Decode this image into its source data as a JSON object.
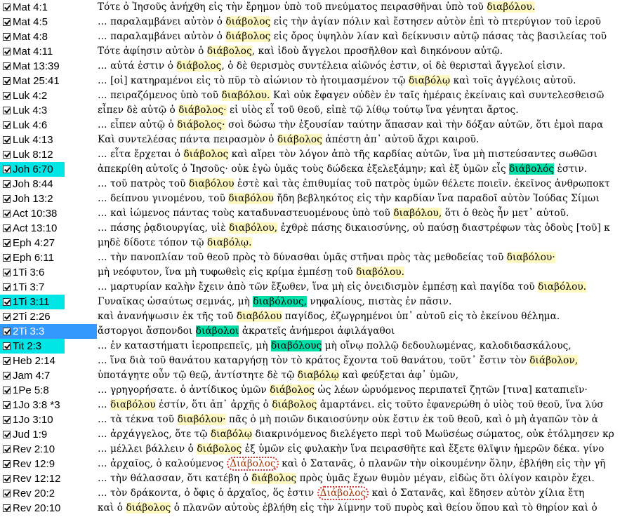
{
  "rows": [
    {
      "ref": "Mat 4:1",
      "sel": "",
      "segs": [
        {
          "t": "Τότε ὁ Ἰησοῦς ἀνήχθη εἰς τὴν ἔρημον ὑπὸ τοῦ πνεύματος πειρασθῆναι ὑπὸ τοῦ "
        },
        {
          "t": "διαβόλου.",
          "h": "hl"
        }
      ]
    },
    {
      "ref": "Mat 4:5",
      "sel": "",
      "segs": [
        {
          "t": "… παραλαμβάνει αὐτὸν ὁ "
        },
        {
          "t": "διάβολος",
          "h": "hl"
        },
        {
          "t": " εἰς τὴν ἁγίαν πόλιν καὶ ἔστησεν αὐτὸν ἐπὶ τὸ πτερύγιον τοῦ ἱεροῦ"
        }
      ]
    },
    {
      "ref": "Mat 4:8",
      "sel": "",
      "segs": [
        {
          "t": "… παραλαμβάνει αὐτὸν ὁ "
        },
        {
          "t": "διάβολος",
          "h": "hl"
        },
        {
          "t": " εἰς ὄρος ὑψηλὸν λίαν καὶ δείκνυσιν αὐτῷ πάσας τὰς βασιλείας τοῦ"
        }
      ]
    },
    {
      "ref": "Mat 4:11",
      "sel": "",
      "segs": [
        {
          "t": "Τότε ἀφίησιν αὐτὸν ὁ "
        },
        {
          "t": "διάβολος",
          "h": "hl"
        },
        {
          "t": ", καὶ ἰδοὺ ἄγγελοι προσῆλθον καὶ διηκόνουν αὐτῷ."
        }
      ]
    },
    {
      "ref": "Mat 13:39",
      "sel": "",
      "segs": [
        {
          "t": "… αὐτά ἐστιν ὁ "
        },
        {
          "t": "διάβολος",
          "h": "hl"
        },
        {
          "t": ", ὁ δὲ θερισμὸς συντέλεια αἰῶνός ἐστιν, οἱ δὲ θερισταὶ ἄγγελοί εἰσιν."
        }
      ]
    },
    {
      "ref": "Mat 25:41",
      "sel": "",
      "segs": [
        {
          "t": "… [οἱ] κατηραμένοι εἰς τὸ πῦρ τὸ αἰώνιον τὸ ἡτοιμασμένον τῷ "
        },
        {
          "t": "διαβόλῳ",
          "h": "hl"
        },
        {
          "t": " καὶ τοῖς ἀγγέλοις αὐτοῦ."
        }
      ]
    },
    {
      "ref": "Luk 4:2",
      "sel": "",
      "segs": [
        {
          "t": "… πειραζόμενος ὑπὸ τοῦ "
        },
        {
          "t": "διαβόλου.",
          "h": "hl"
        },
        {
          "t": " Καὶ οὐκ ἔφαγεν οὐδὲν ἐν ταῖς ἡμέραις ἐκείναις καὶ συντελεσθεισῶ"
        }
      ]
    },
    {
      "ref": "Luk 4:3",
      "sel": "",
      "segs": [
        {
          "t": "εἶπεν δὲ αὐτῷ ὁ "
        },
        {
          "t": "διάβολος·",
          "h": "hl"
        },
        {
          "t": " εἰ υἱὸς εἶ τοῦ θεοῦ, εἰπὲ τῷ λίθῳ τούτῳ ἵνα γένηται ἄρτος."
        }
      ]
    },
    {
      "ref": "Luk 4:6",
      "sel": "",
      "segs": [
        {
          "t": "… εἶπεν αὐτῷ ὁ "
        },
        {
          "t": "διάβολος·",
          "h": "hl"
        },
        {
          "t": " σοὶ δώσω τὴν ἐξουσίαν ταύτην ἅπασαν καὶ τὴν δόξαν αὐτῶν, ὅτι ἐμοὶ παρα"
        }
      ]
    },
    {
      "ref": "Luk 4:13",
      "sel": "",
      "segs": [
        {
          "t": "Καὶ συντελέσας πάντα πειρασμὸν ὁ "
        },
        {
          "t": "διάβολος",
          "h": "hl"
        },
        {
          "t": " ἀπέστη ἀπ᾽ αὐτοῦ ἄχρι καιροῦ."
        }
      ]
    },
    {
      "ref": "Luk 8:12",
      "sel": "",
      "segs": [
        {
          "t": "… εἶτα ἔρχεται ὁ "
        },
        {
          "t": "διάβολος",
          "h": "hl"
        },
        {
          "t": " καὶ αἴρει τὸν λόγον ἀπὸ τῆς καρδίας αὐτῶν, ἵνα μὴ πιστεύσαντες σωθῶσι"
        }
      ]
    },
    {
      "ref": "Joh 6:70",
      "sel": "cyan",
      "segs": [
        {
          "t": "ἀπεκρίθη αὐτοῖς ὁ Ἰησοῦς· οὐκ ἐγὼ ὑμᾶς τοὺς δώδεκα ἐξελεξάμην; καὶ ἐξ ὑμῶν εἷς "
        },
        {
          "t": "διάβολός",
          "h": "hl-strong"
        },
        {
          "t": " ἐστιν."
        }
      ]
    },
    {
      "ref": "Joh 8:44",
      "sel": "",
      "segs": [
        {
          "t": "… τοῦ πατρὸς τοῦ "
        },
        {
          "t": "διαβόλου",
          "h": "hl"
        },
        {
          "t": " ἐστὲ καὶ τὰς ἐπιθυμίας τοῦ πατρὸς ὑμῶν θέλετε ποιεῖν. ἐκεῖνος ἀνθρωποκτ"
        }
      ]
    },
    {
      "ref": "Joh 13:2",
      "sel": "",
      "segs": [
        {
          "t": "… δείπνου γινομένου, τοῦ "
        },
        {
          "t": "διαβόλου",
          "h": "hl"
        },
        {
          "t": " ἤδη βεβληκότος εἰς τὴν καρδίαν ἵνα παραδοῖ αὐτὸν Ἰούδας Σίμωι"
        }
      ]
    },
    {
      "ref": "Act 10:38",
      "sel": "",
      "segs": [
        {
          "t": "… καὶ ἰώμενος πάντας τοὺς καταδυναστευομένους ὑπὸ τοῦ "
        },
        {
          "t": "διαβόλου,",
          "h": "hl"
        },
        {
          "t": " ὅτι ὁ θεὸς ἦν μετ᾽ αὐτοῦ."
        }
      ]
    },
    {
      "ref": "Act 13:10",
      "sel": "",
      "segs": [
        {
          "t": "… πάσης ῥᾳδιουργίας, υἱὲ "
        },
        {
          "t": "διαβόλου,",
          "h": "hl"
        },
        {
          "t": " ἐχθρὲ πάσης δικαιοσύνης, οὐ παύσῃ διαστρέφων τὰς ὁδοὺς [τοῦ] κ"
        }
      ]
    },
    {
      "ref": "Eph 4:27",
      "sel": "",
      "segs": [
        {
          "t": "μηδὲ δίδοτε τόπον τῷ "
        },
        {
          "t": "διαβόλῳ.",
          "h": "hl"
        }
      ]
    },
    {
      "ref": "Eph 6:11",
      "sel": "",
      "segs": [
        {
          "t": "… τὴν πανοπλίαν τοῦ θεοῦ πρὸς τὸ δύνασθαι ὑμᾶς στῆναι πρὸς τὰς μεθοδείας τοῦ "
        },
        {
          "t": "διαβόλου·",
          "h": "hl"
        }
      ]
    },
    {
      "ref": "1Ti 3:6",
      "sel": "",
      "segs": [
        {
          "t": "μὴ νεόφυτον, ἵνα μὴ τυφωθεὶς εἰς κρίμα ἐμπέσῃ τοῦ "
        },
        {
          "t": "διαβόλου.",
          "h": "hl"
        }
      ]
    },
    {
      "ref": "1Ti 3:7",
      "sel": "",
      "segs": [
        {
          "t": "… μαρτυρίαν καλὴν ἔχειν ἀπὸ τῶν ἔξωθεν, ἵνα μὴ εἰς ὀνειδισμὸν ἐμπέσῃ καὶ παγίδα τοῦ "
        },
        {
          "t": "διαβόλου.",
          "h": "hl"
        }
      ]
    },
    {
      "ref": "1Ti 3:11",
      "sel": "cyan",
      "segs": [
        {
          "t": "Γυναῖκας ὡσαύτως σεμνάς, μὴ "
        },
        {
          "t": "διαβόλους,",
          "h": "hl-strong"
        },
        {
          "t": " νηφαλίους, πιστὰς ἐν πᾶσιν."
        }
      ]
    },
    {
      "ref": "2Ti 2:26",
      "sel": "",
      "segs": [
        {
          "t": "καὶ ἀνανήψωσιν ἐκ τῆς τοῦ "
        },
        {
          "t": "διαβόλου",
          "h": "hl"
        },
        {
          "t": " παγίδος, ἐζωγρημένοι ὑπ᾽ αὐτοῦ εἰς τὸ ἐκείνου θέλημα."
        }
      ]
    },
    {
      "ref": "2Ti 3:3",
      "sel": "blue",
      "segs": [
        {
          "t": "ἄστοργοι ἄσπονδοι "
        },
        {
          "t": "διάβολοι",
          "h": "hl-strong"
        },
        {
          "t": " ἀκρατεῖς ἀνήμεροι ἀφιλάγαθοι"
        }
      ]
    },
    {
      "ref": "Tit 2:3",
      "sel": "cyan",
      "segs": [
        {
          "t": "… ἐν καταστήματι ἱεροπρεπεῖς, μὴ "
        },
        {
          "t": "διαβόλους",
          "h": "hl-strong"
        },
        {
          "t": " μὴ οἴνῳ πολλῷ δεδουλωμένας, καλοδιδασκάλους,"
        }
      ]
    },
    {
      "ref": "Heb 2:14",
      "sel": "",
      "segs": [
        {
          "t": "… ἵνα διὰ τοῦ θανάτου καταργήσῃ τὸν τὸ κράτος ἔχοντα τοῦ θανάτου, τοῦτ᾽ ἔστιν τὸν "
        },
        {
          "t": "διάβολον,",
          "h": "hl"
        }
      ]
    },
    {
      "ref": "Jam 4:7",
      "sel": "",
      "segs": [
        {
          "t": "ὑποτάγητε οὖν τῷ θεῷ, ἀντίστητε δὲ τῷ "
        },
        {
          "t": "διαβόλῳ",
          "h": "hl"
        },
        {
          "t": " καὶ φεύξεται ἀφ᾽ ὑμῶν,"
        }
      ]
    },
    {
      "ref": "1Pe 5:8",
      "sel": "",
      "segs": [
        {
          "t": "… γρηγορήσατε. ὁ ἀντίδικος ὑμῶν "
        },
        {
          "t": "διάβολος",
          "h": "hl"
        },
        {
          "t": " ὡς λέων ὠρυόμενος περιπατεῖ ζητῶν [τινα] καταπιεῖν·"
        }
      ]
    },
    {
      "ref": "1Jo 3:8 *3",
      "sel": "",
      "segs": [
        {
          "t": "… "
        },
        {
          "t": "διαβόλου",
          "h": "hl"
        },
        {
          "t": " ἐστίν, ὅτι ἀπ᾽ ἀρχῆς ὁ "
        },
        {
          "t": "διάβολος",
          "h": "hl"
        },
        {
          "t": " ἁμαρτάνει. εἰς τοῦτο ἐφανερώθη ὁ υἱὸς τοῦ θεοῦ, ἵνα λύσ"
        }
      ]
    },
    {
      "ref": "1Jo 3:10",
      "sel": "",
      "segs": [
        {
          "t": "… τὰ τέκνα τοῦ "
        },
        {
          "t": "διαβόλου·",
          "h": "hl"
        },
        {
          "t": " πᾶς ὁ μὴ ποιῶν δικαιοσύνην οὐκ ἔστιν ἐκ τοῦ θεοῦ, καὶ ὁ μὴ ἀγαπῶν τὸν ἀ"
        }
      ]
    },
    {
      "ref": "Jud 1:9",
      "sel": "",
      "segs": [
        {
          "t": "… ἀρχάγγελος, ὅτε τῷ "
        },
        {
          "t": "διαβόλῳ",
          "h": "hl"
        },
        {
          "t": " διακρινόμενος διελέγετο περὶ τοῦ Μωϋσέως σώματος, οὐκ ἐτόλμησεν κρ"
        }
      ]
    },
    {
      "ref": "Rev 2:10",
      "sel": "",
      "segs": [
        {
          "t": "… μέλλει βάλλειν ὁ "
        },
        {
          "t": "διάβολος",
          "h": "hl"
        },
        {
          "t": " ἐξ ὑμῶν εἰς φυλακὴν ἵνα πειρασθῆτε καὶ ἕξετε θλῖψιν ἡμερῶν δέκα. γίνο"
        }
      ]
    },
    {
      "ref": "Rev 12:9",
      "sel": "",
      "segs": [
        {
          "t": "… ἀρχαῖος, ὁ καλούμενος "
        },
        {
          "t": "Διάβολος",
          "h": "circ"
        },
        {
          "t": " καὶ ὁ Σατανᾶς, ὁ πλανῶν τὴν οἰκουμένην ὅλην, ἐβλήθη εἰς τὴν γῆ"
        }
      ]
    },
    {
      "ref": "Rev 12:12",
      "sel": "",
      "segs": [
        {
          "t": "… τὴν θάλασσαν, ὅτι κατέβη ὁ "
        },
        {
          "t": "διάβολος",
          "h": "hl"
        },
        {
          "t": " πρὸς ὑμᾶς ἔχων θυμὸν μέγαν, εἰδὼς ὅτι ὀλίγον καιρὸν ἔχει."
        }
      ]
    },
    {
      "ref": "Rev 20:2",
      "sel": "",
      "segs": [
        {
          "t": "… τὸν δράκοντα, ὁ ὄφις ὁ ἀρχαῖος, ὅς ἐστιν "
        },
        {
          "t": "Διάβολος",
          "h": "circ"
        },
        {
          "t": " καὶ ὁ Σατανᾶς, καὶ ἔδησεν αὐτὸν χίλια ἔτη"
        }
      ]
    },
    {
      "ref": "Rev 20:10",
      "sel": "",
      "segs": [
        {
          "t": "καὶ ὁ "
        },
        {
          "t": "διάβολος",
          "h": "hl"
        },
        {
          "t": " ὁ πλανῶν αὐτοὺς ἐβλήθη εἰς τὴν λίμνην τοῦ πυρὸς καὶ θείου ὅπου καὶ τὸ θηρίον καὶ ὁ"
        }
      ]
    }
  ]
}
